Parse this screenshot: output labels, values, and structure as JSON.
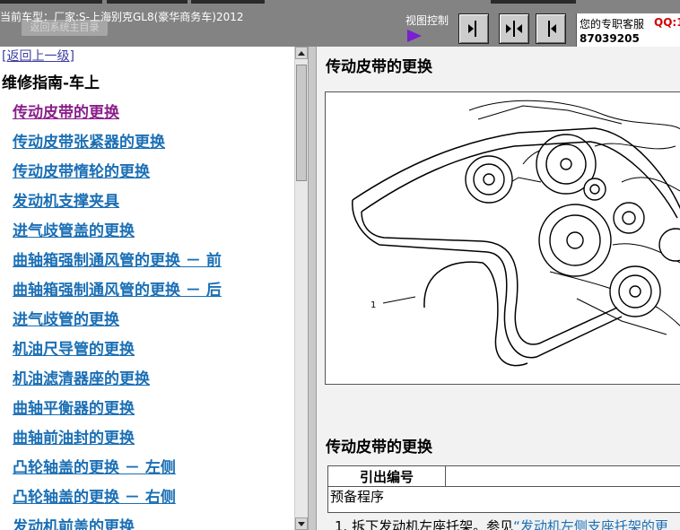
{
  "header": {
    "current_model": "当前车型：厂家:S-上海别克GL8(豪华商务车)2012",
    "back_to_catalog": "返回系统主目录",
    "view_control_label": "视图控制",
    "support_label": "您的专职客服",
    "support_qq": "QQ:1",
    "support_number": "87039205"
  },
  "sidebar": {
    "back_link": "[返回上一级]",
    "section_title": "维修指南-车上",
    "items": [
      {
        "label": "传动皮带的更换",
        "visited": true
      },
      {
        "label": "传动皮带张紧器的更换"
      },
      {
        "label": "传动皮带惰轮的更换"
      },
      {
        "label": "发动机支撑夹具"
      },
      {
        "label": "进气歧管盖的更换"
      },
      {
        "label": "曲轴箱强制通风管的更换 － 前"
      },
      {
        "label": "曲轴箱强制通风管的更换 － 后"
      },
      {
        "label": "进气歧管的更换"
      },
      {
        "label": "机油尺导管的更换"
      },
      {
        "label": "机油滤清器座的更换"
      },
      {
        "label": "曲轴平衡器的更换"
      },
      {
        "label": "曲轴前油封的更换"
      },
      {
        "label": "凸轮轴盖的更换 － 左侧"
      },
      {
        "label": "凸轮轴盖的更换 － 右侧"
      },
      {
        "label": "发动机前盖的更换"
      }
    ]
  },
  "content": {
    "title": "传动皮带的更换",
    "figure_callout": "1",
    "title2": "传动皮带的更换",
    "table_header": "引出编号",
    "table_row": "预备程序",
    "cut_text_before": "1. 拆下发动机左座托架。参见",
    "cut_text_link": "“发动机左侧支座托架的更"
  }
}
